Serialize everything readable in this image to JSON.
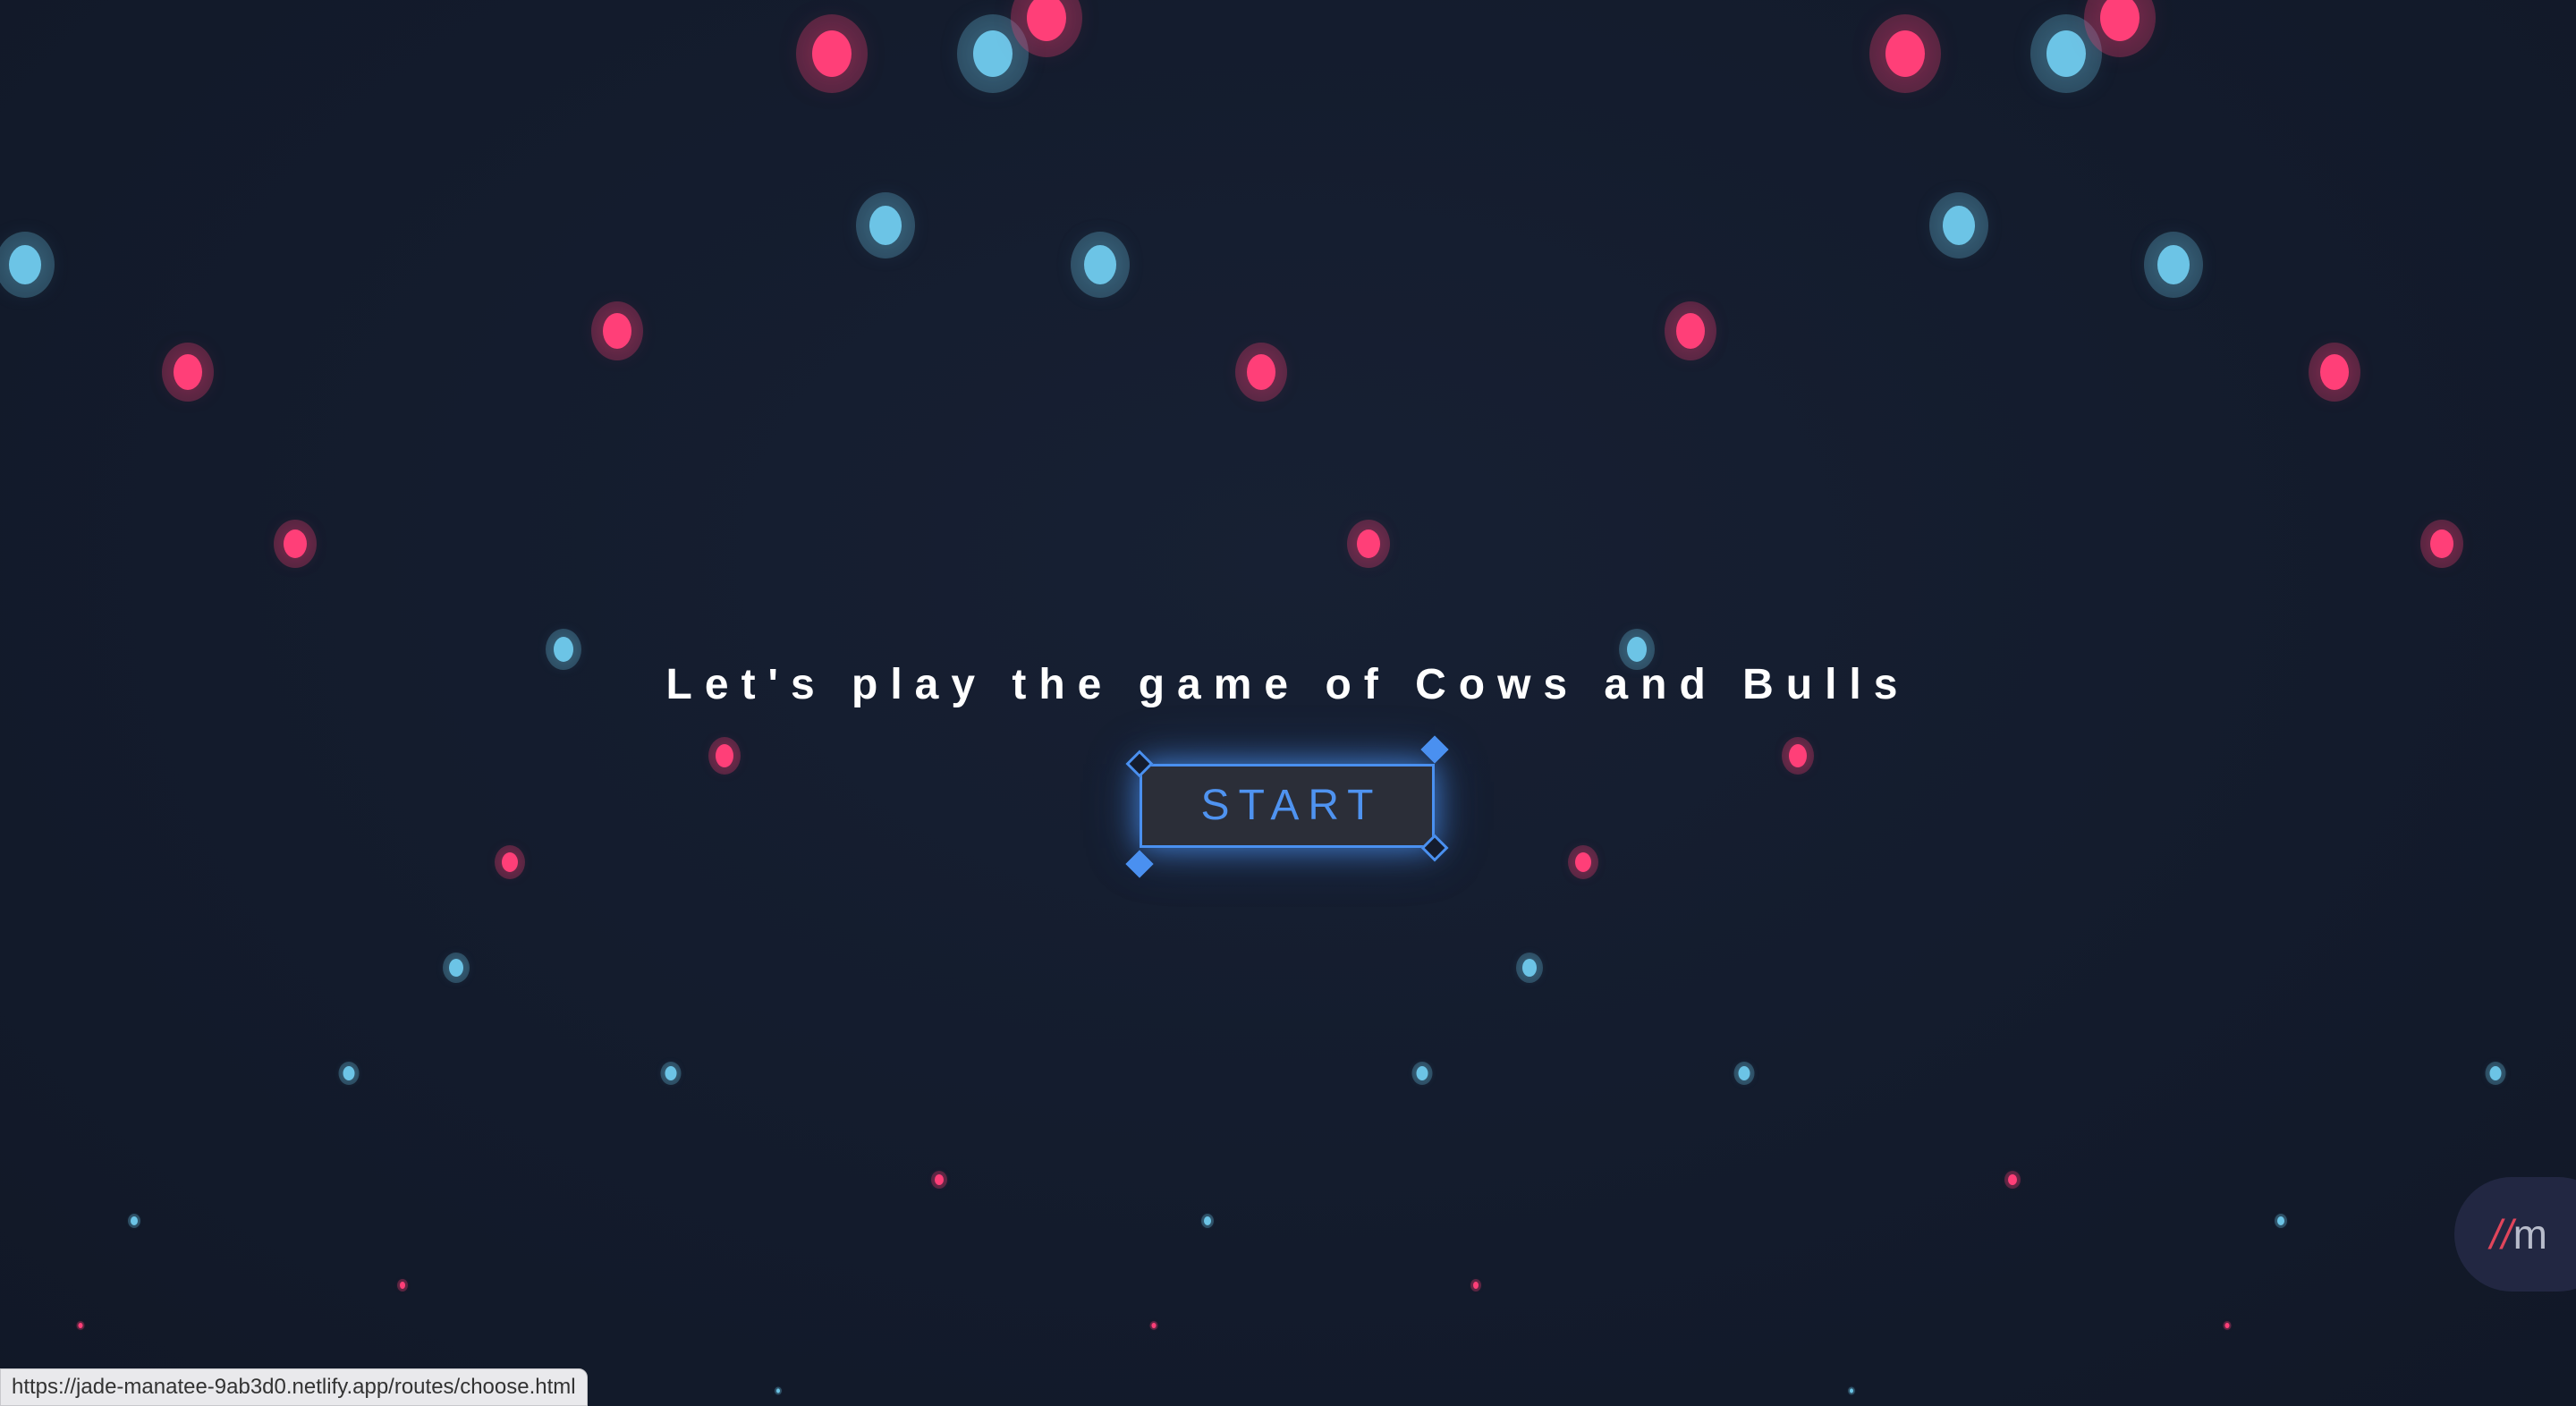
{
  "title": "Let's play the game of Cows and Bulls",
  "start_button": {
    "label": "START"
  },
  "status_bar": {
    "url": "https://jade-manatee-9ab3d0.netlify.app/routes/choose.html"
  },
  "badge": {
    "slashes": "//",
    "letter": "m"
  },
  "colors": {
    "background": "#141c2e",
    "pink_dot": "#ff3f78",
    "blue_dot": "#6cc4e6",
    "accent": "#4a90f0",
    "button_fill": "#2b2e38"
  },
  "icons": [
    "corner-diamond-icon",
    "badge-logo-icon"
  ]
}
